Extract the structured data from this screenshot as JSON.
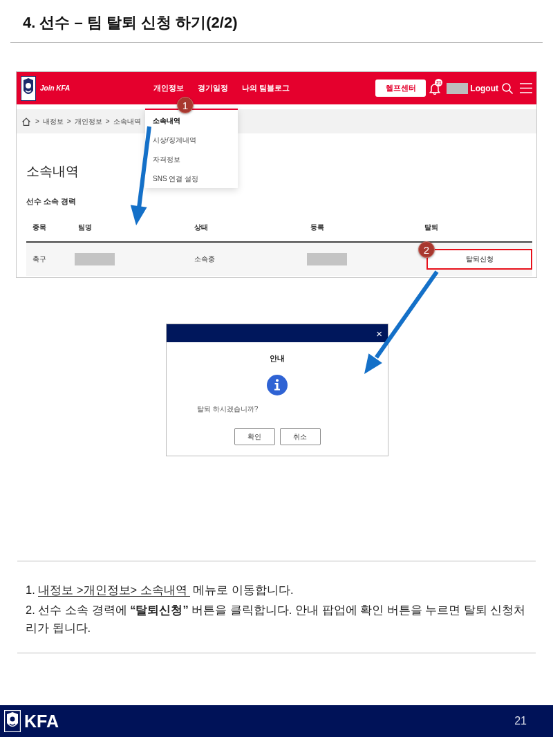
{
  "slide_title": "4. 선수 – 팀 탈퇴 신청 하기(2/2)",
  "site": {
    "logo_text": "Join KFA",
    "nav": [
      "개인정보",
      "경기일정",
      "나의 팀블로그"
    ],
    "help_button": "헬프센터",
    "notification_count": "21",
    "logout": "Logout",
    "breadcrumb": {
      "separator": ">",
      "items": [
        "내정보",
        "개인정보",
        "소속내역"
      ]
    },
    "dropdown": [
      {
        "label": "소속내역",
        "selected": true
      },
      {
        "label": "시상/징계내역",
        "selected": false
      },
      {
        "label": "자격정보",
        "selected": false
      },
      {
        "label": "SNS 연결 설정",
        "selected": false
      }
    ],
    "page_heading": "소속내역",
    "section_title": "선수 소속 경력",
    "table": {
      "columns": [
        "종목",
        "팀명",
        "상태",
        "등록",
        "탈퇴"
      ],
      "rows": [
        {
          "cells": [
            {
              "kind": "text",
              "text": "축구"
            },
            {
              "kind": "redacted"
            },
            {
              "kind": "text",
              "text": "소속중"
            },
            {
              "kind": "redacted"
            },
            {
              "kind": "button",
              "text": "탈퇴신청",
              "highlighted": true
            }
          ]
        }
      ]
    }
  },
  "dialog": {
    "close": "×",
    "title": "안내",
    "message": "탈퇴 하시겠습니까?",
    "buttons": [
      "확인",
      "취소"
    ]
  },
  "step_markers": [
    "1",
    "2"
  ],
  "instructions": [
    {
      "number": "1.",
      "link": "내정보 >개인정보> 소속내역",
      "text": "메뉴로 이동합니다."
    },
    {
      "number": "2.",
      "text": "선수 소속 경력에 **“탈퇴신청”**  버튼을 클릭합니다. 안내 팝업에 확인 버튼을 누르면 탈퇴 신청처리가 됩니다."
    }
  ],
  "footer": {
    "logo_text": "KFA",
    "page_number": "21"
  }
}
